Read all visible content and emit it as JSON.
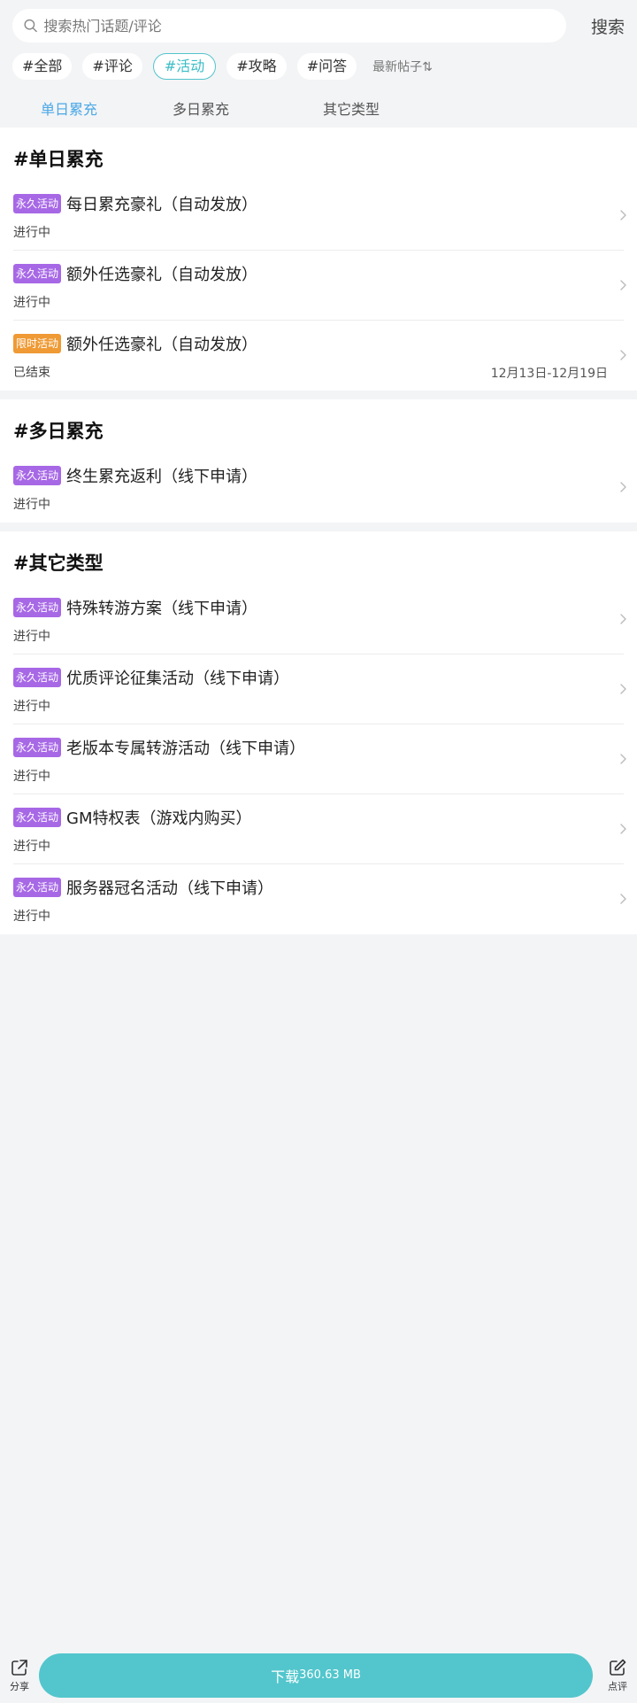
{
  "search": {
    "placeholder": "搜索热门话题/评论",
    "button": "搜索"
  },
  "filters": {
    "chips": [
      "#全部",
      "#评论",
      "#活动",
      "#攻略",
      "#问答"
    ],
    "active_index": 2,
    "sort_label": "最新帖子⇅"
  },
  "tabs": [
    "单日累充",
    "多日累充",
    "其它类型"
  ],
  "sections": [
    {
      "title": "#单日累充",
      "items": [
        {
          "badge": "永久活动",
          "title": "每日累充豪礼（自动发放）",
          "status": "进行中",
          "date": ""
        },
        {
          "badge": "永久活动",
          "title": "额外任选豪礼（自动发放）",
          "status": "进行中",
          "date": ""
        },
        {
          "badge": "限时活动",
          "title": "额外任选豪礼（自动发放）",
          "status": "已结束",
          "date": "12月13日-12月19日"
        }
      ]
    },
    {
      "title": "#多日累充",
      "items": [
        {
          "badge": "永久活动",
          "title": "终生累充返利（线下申请）",
          "status": "进行中",
          "date": ""
        }
      ]
    },
    {
      "title": "#其它类型",
      "items": [
        {
          "badge": "永久活动",
          "title": "特殊转游方案（线下申请）",
          "status": "进行中",
          "date": ""
        },
        {
          "badge": "永久活动",
          "title": "优质评论征集活动（线下申请）",
          "status": "进行中",
          "date": ""
        },
        {
          "badge": "永久活动",
          "title": "老版本专属转游活动（线下申请）",
          "status": "进行中",
          "date": ""
        },
        {
          "badge": "永久活动",
          "title": "GM特权表（游戏内购买）",
          "status": "进行中",
          "date": ""
        },
        {
          "badge": "永久活动",
          "title": "服务器冠名活动（线下申请）",
          "status": "进行中",
          "date": ""
        }
      ]
    }
  ],
  "bottom": {
    "share_label": "分享",
    "download_label": "下载",
    "download_size": "360.63 MB",
    "review_label": "点评"
  },
  "colors": {
    "accent": "#52c6cc",
    "tab_active": "#4aa8e6",
    "badge_permanent": "#a768e6",
    "badge_limited": "#ef9a34"
  },
  "icons": {
    "search": "search-icon",
    "chevron": "chevron-right-icon",
    "share": "share-icon",
    "review": "edit-icon"
  }
}
